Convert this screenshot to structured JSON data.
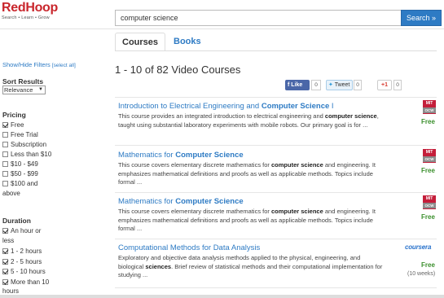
{
  "header": {
    "logo_text": "RedHoop",
    "logo_tagline": "Search • Learn • Grow",
    "search_value": "computer science",
    "search_button": "Search »"
  },
  "tabs": [
    {
      "label": "Courses",
      "active": true
    },
    {
      "label": "Books",
      "active": false
    }
  ],
  "sidebar": {
    "filter_toggle": "Show/Hide Filters",
    "select_all": "[select all]",
    "sort_heading": "Sort Results",
    "sort_value": "Relevance",
    "pricing_heading": "Pricing",
    "pricing": [
      {
        "label": "Free",
        "checked": true
      },
      {
        "label": "Free Trial",
        "checked": false
      },
      {
        "label": "Subscription",
        "checked": false
      },
      {
        "label": "Less than $10",
        "checked": false
      },
      {
        "label": "$10 - $49",
        "checked": false
      },
      {
        "label": "$50 - $99",
        "checked": false
      },
      {
        "label": "$100 and",
        "label2": "above",
        "checked": false
      }
    ],
    "duration_heading": "Duration",
    "duration": [
      {
        "label": "An hour or",
        "label2": "less",
        "checked": true
      },
      {
        "label": "1 - 2 hours",
        "checked": true
      },
      {
        "label": "2 - 5 hours",
        "checked": true
      },
      {
        "label": "5 - 10 hours",
        "checked": true
      },
      {
        "label": "More than 10",
        "label2": "hours",
        "checked": true
      }
    ]
  },
  "results_summary": "1 - 10 of 82 Video Courses",
  "social": {
    "like_label": "Like",
    "like_count": "0",
    "tweet_label": "Tweet",
    "tweet_count": "0",
    "gplus_label": "+1",
    "gplus_count": "0"
  },
  "results": [
    {
      "title_pre": "Introduction to Electrical Engineering and ",
      "title_bold": "Computer Science",
      "title_post": " I",
      "desc_html_parts": [
        "This course provides an integrated introduction to electrical engineering and ",
        "computer science",
        ", taught using substantial laboratory experiments with mobile robots. Our primary goal is for ..."
      ],
      "provider": "MIT OCW",
      "price": "Free"
    },
    {
      "title_pre": "Mathematics for ",
      "title_bold": "Computer Science",
      "title_post": "",
      "desc_html_parts": [
        "This course covers elementary discrete mathematics for ",
        "computer science",
        " and engineering. It emphasizes mathematical definitions and proofs as well as applicable methods. Topics include formal ..."
      ],
      "provider": "MIT OCW",
      "price": "Free"
    },
    {
      "title_pre": "Mathematics for ",
      "title_bold": "Computer Science",
      "title_post": "",
      "desc_html_parts": [
        "This course covers elementary discrete mathematics for ",
        "computer science",
        " and engineering. It emphasizes mathematical definitions and proofs as well as applicable methods. Topics include formal ..."
      ],
      "provider": "MIT OCW",
      "price": "Free"
    },
    {
      "title_pre": "Computational Methods for Data Analysis",
      "title_bold": "",
      "title_post": "",
      "desc_html_parts": [
        "Exploratory and objective data analysis methods applied to the physical, engineering, and biological ",
        "sciences",
        ". Brief review of statistical methods and their computational implementation for studying ..."
      ],
      "provider": "coursera",
      "price": "Free",
      "duration": "(10 weeks)"
    }
  ],
  "colors": {
    "brand_red": "#c9262c",
    "link_blue": "#2e7bc4",
    "free_green": "#3a8f2c"
  }
}
